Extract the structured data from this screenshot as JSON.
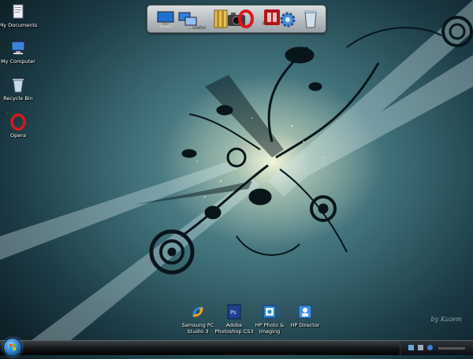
{
  "desktop_icons": [
    {
      "label": "My Documents",
      "icon": "documents-icon"
    },
    {
      "label": "My Computer",
      "icon": "computer-icon"
    },
    {
      "label": "Recycle Bin",
      "icon": "recycle-bin-icon"
    },
    {
      "label": "Opera",
      "icon": "opera-icon"
    }
  ],
  "dock": {
    "items": [
      {
        "icon": "computer-icon"
      },
      {
        "icon": "network-icon"
      },
      {
        "icon": "folder-icon"
      },
      {
        "icon": "camera-icon"
      },
      {
        "icon": "opera-icon"
      },
      {
        "icon": "red-app-icon"
      },
      {
        "icon": "settings-gear-icon"
      },
      {
        "icon": "trash-icon"
      }
    ],
    "labels": [
      "…ulator",
      "Fl…",
      "Fl..."
    ]
  },
  "bottom_icons": [
    {
      "label_line1": "Samsung PC",
      "label_line2": "Studio 3",
      "icon": "samsung-pc-studio-icon"
    },
    {
      "label_line1": "Adobe",
      "label_line2": "Photoshop CS3",
      "icon": "photoshop-icon"
    },
    {
      "label_line1": "HP Photo &",
      "label_line2": "Imaging",
      "icon": "hp-photo-icon"
    },
    {
      "label_line1": "HP Director",
      "label_line2": "",
      "icon": "hp-director-icon"
    }
  ],
  "signature": "by Kazem",
  "taskbar": {
    "start_icon": "windows-start-orb"
  },
  "colors": {
    "bg_dark": "#0e2028",
    "bg_mid": "#3e6e77",
    "glow": "#f8fadc",
    "taskbar": "#111416"
  }
}
